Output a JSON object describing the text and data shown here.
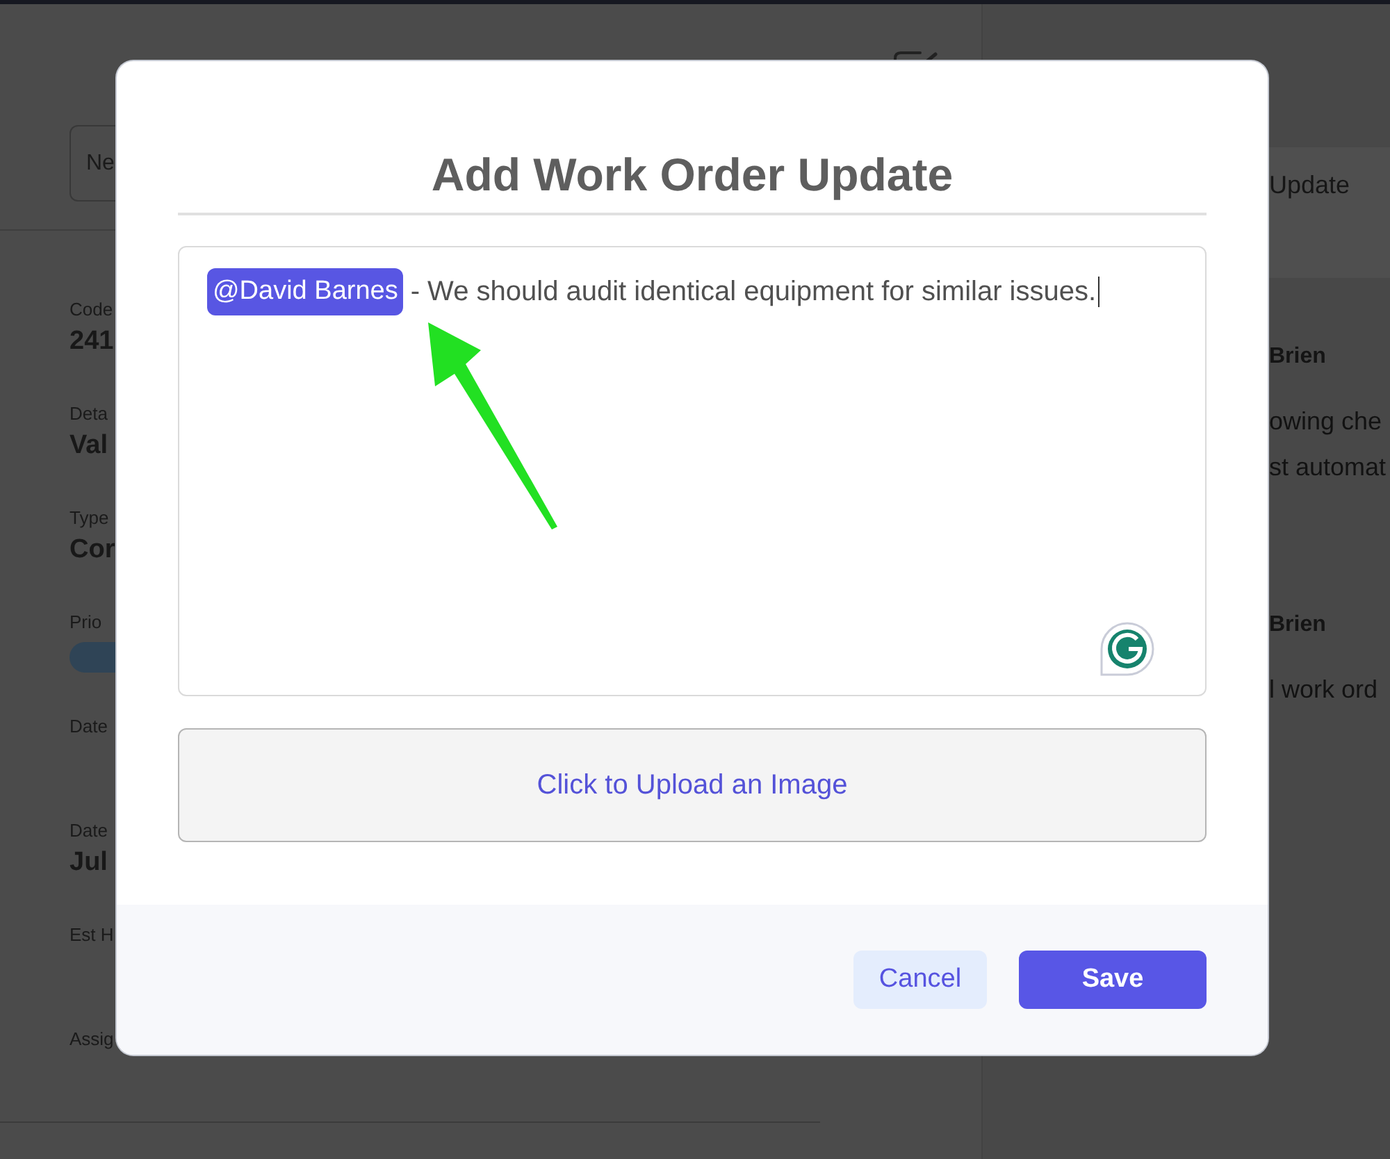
{
  "background_page": {
    "left_panel": {
      "button_label": "Ne",
      "fields": [
        {
          "label": "Code",
          "kind": "value",
          "value": "241"
        },
        {
          "label": "Deta",
          "kind": "value",
          "value": "Val"
        },
        {
          "label": "Type",
          "kind": "value",
          "value": "Cor"
        },
        {
          "label": "Prio",
          "kind": "badge"
        },
        {
          "label": "Date",
          "kind": "blank"
        },
        {
          "label": "Date",
          "kind": "value",
          "value": "Jul"
        },
        {
          "label": "Est H",
          "kind": "blank"
        },
        {
          "label": "Assig",
          "kind": "blank"
        }
      ]
    },
    "right_panel": {
      "header": "Update",
      "updates": [
        {
          "author": "Brien",
          "lines": [
            "owing che",
            "st automat"
          ]
        },
        {
          "author": "Brien",
          "lines": [
            "l work ord"
          ]
        }
      ]
    }
  },
  "modal": {
    "title": "Add Work Order Update",
    "editor": {
      "mention": "@David Barnes",
      "text": "- We should audit identical equipment for similar issues."
    },
    "upload_label": "Click to Upload an Image",
    "buttons": [
      {
        "label": "Cancel",
        "kind": "secondary"
      },
      {
        "label": "Save",
        "kind": "primary"
      }
    ]
  }
}
